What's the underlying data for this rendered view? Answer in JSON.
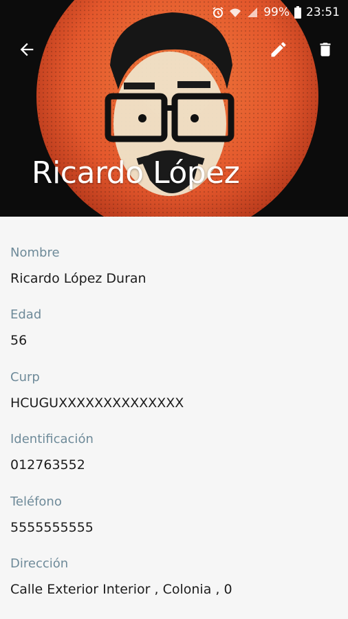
{
  "status_bar": {
    "battery": "99%",
    "time": "23:51",
    "icons": [
      "alarm-icon",
      "wifi-icon",
      "signal-icon",
      "battery-icon"
    ]
  },
  "toolbar": {
    "back_icon": "arrow-left-icon",
    "edit_icon": "pencil-icon",
    "delete_icon": "trash-icon"
  },
  "header": {
    "title": "Ricardo López"
  },
  "fields": [
    {
      "label": "Nombre",
      "value": "Ricardo López  Duran"
    },
    {
      "label": "Edad",
      "value": "56"
    },
    {
      "label": "Curp",
      "value": "HCUGUXXXXXXXXXXXXXX"
    },
    {
      "label": "Identificación",
      "value": "012763552"
    },
    {
      "label": "Teléfono",
      "value": "5555555555"
    },
    {
      "label": "Dirección",
      "value": "Calle Exterior Interior , Colonia , 0"
    }
  ],
  "colors": {
    "label": "#6e8a99",
    "value": "#1c1c1c",
    "background": "#f6f6f6",
    "avatar_orange": "#e3572c"
  }
}
